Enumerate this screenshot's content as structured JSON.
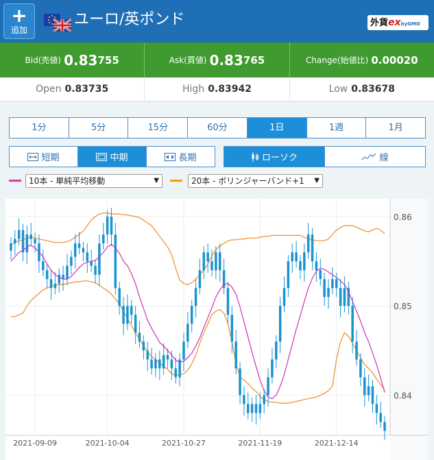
{
  "header": {
    "add_label": "追加",
    "title": "ユーロ/英ポンド",
    "logo_main": "外貨",
    "logo_ex": "ex",
    "logo_sub": "byGMO",
    "colors": {
      "header_bg": "#1e6fb6",
      "quote_bg": "#3f9a2f"
    }
  },
  "quote": {
    "bid_label": "Bid(売値)",
    "bid_big": "0.83",
    "bid_small": "755",
    "ask_label": "Ask(買値)",
    "ask_big": "0.83",
    "ask_small": "765",
    "change_label": "Change(始値比)",
    "change_value": "0.00020"
  },
  "ohl": {
    "open_label": "Open",
    "open_value": "0.83735",
    "high_label": "High",
    "high_value": "0.83942",
    "low_label": "Low",
    "low_value": "0.83678"
  },
  "periods": [
    {
      "label": "1分",
      "active": false
    },
    {
      "label": "5分",
      "active": false
    },
    {
      "label": "15分",
      "active": false
    },
    {
      "label": "60分",
      "active": false
    },
    {
      "label": "1日",
      "active": true
    },
    {
      "label": "1週",
      "active": false
    },
    {
      "label": "1月",
      "active": false
    }
  ],
  "ranges": {
    "short": "短期",
    "mid": "中期",
    "long": "長期",
    "active": "mid"
  },
  "chart_types": {
    "candle": "ローソク",
    "line": "線",
    "active": "candle"
  },
  "indicators": {
    "ma_label": "10本 - 単純平均移動",
    "ma_color": "#d63aa5",
    "bb_label": "20本 - ボリンジャーバンド+1",
    "bb_color": "#f0a000"
  },
  "chart_data": {
    "type": "candlestick",
    "ylim": [
      0.8355,
      0.862
    ],
    "y_ticks": [
      0.84,
      0.85,
      0.86
    ],
    "y_tick_labels": [
      "0.84",
      "0.85",
      "0.86"
    ],
    "x_tick_labels": [
      "2021-09-09",
      "2021-10-04",
      "2021-10-27",
      "2021-11-19",
      "2021-12-14"
    ],
    "x_tick_index": [
      6,
      24,
      43,
      62,
      81
    ],
    "candle_color": "#1a93cf",
    "ma_color": "#c733b8",
    "bb_color": "#f08a24",
    "close": [
      0.857,
      0.8575,
      0.8585,
      0.856,
      0.858,
      0.8575,
      0.857,
      0.855,
      0.854,
      0.853,
      0.852,
      0.8525,
      0.8535,
      0.853,
      0.8545,
      0.8555,
      0.857,
      0.8565,
      0.856,
      0.855,
      0.8545,
      0.8535,
      0.857,
      0.858,
      0.86,
      0.858,
      0.852,
      0.85,
      0.848,
      0.85,
      0.849,
      0.847,
      0.846,
      0.845,
      0.844,
      0.843,
      0.844,
      0.843,
      0.8445,
      0.844,
      0.843,
      0.842,
      0.844,
      0.846,
      0.848,
      0.85,
      0.852,
      0.854,
      0.856,
      0.855,
      0.854,
      0.856,
      0.854,
      0.852,
      0.849,
      0.846,
      0.843,
      0.84,
      0.839,
      0.838,
      0.839,
      0.838,
      0.839,
      0.84,
      0.842,
      0.844,
      0.846,
      0.85,
      0.852,
      0.855,
      0.856,
      0.855,
      0.854,
      0.856,
      0.858,
      0.855,
      0.854,
      0.853,
      0.851,
      0.852,
      0.853,
      0.852,
      0.85,
      0.852,
      0.85,
      0.846,
      0.844,
      0.842,
      0.84,
      0.841,
      0.839,
      0.838,
      0.837,
      0.836
    ],
    "ma10": [
      0.855,
      0.8555,
      0.856,
      0.8562,
      0.8566,
      0.8568,
      0.8565,
      0.856,
      0.8555,
      0.8547,
      0.854,
      0.8535,
      0.8532,
      0.853,
      0.853,
      0.8533,
      0.8538,
      0.8543,
      0.8547,
      0.8549,
      0.855,
      0.8551,
      0.8555,
      0.856,
      0.8566,
      0.8569,
      0.8565,
      0.8559,
      0.855,
      0.8545,
      0.8536,
      0.8525,
      0.851,
      0.8497,
      0.8484,
      0.8475,
      0.8467,
      0.8459,
      0.8455,
      0.845,
      0.8445,
      0.8439,
      0.8437,
      0.8438,
      0.8442,
      0.8447,
      0.8455,
      0.8464,
      0.8476,
      0.8487,
      0.8498,
      0.851,
      0.8518,
      0.8524,
      0.8525,
      0.8521,
      0.8513,
      0.8499,
      0.8482,
      0.8465,
      0.8448,
      0.8432,
      0.8417,
      0.8405,
      0.8398,
      0.8396,
      0.84,
      0.841,
      0.8423,
      0.844,
      0.8457,
      0.8474,
      0.8489,
      0.8505,
      0.852,
      0.8531,
      0.8539,
      0.8542,
      0.8541,
      0.8538,
      0.8535,
      0.8532,
      0.8528,
      0.8524,
      0.8516,
      0.8505,
      0.8494,
      0.8483,
      0.847,
      0.846,
      0.8447,
      0.8434,
      0.8419,
      0.8403
    ],
    "bb_upper": [
      0.8568,
      0.8571,
      0.8573,
      0.8574,
      0.8576,
      0.8577,
      0.8576,
      0.8575,
      0.8574,
      0.8573,
      0.8572,
      0.8571,
      0.8571,
      0.8571,
      0.8572,
      0.8574,
      0.8577,
      0.858,
      0.8584,
      0.859,
      0.8596,
      0.86,
      0.8603,
      0.8604,
      0.8604,
      0.8603,
      0.8603,
      0.8603,
      0.8602,
      0.8602,
      0.8601,
      0.86,
      0.8599,
      0.8596,
      0.8593,
      0.859,
      0.8584,
      0.8578,
      0.8572,
      0.8566,
      0.8557,
      0.8542,
      0.8529,
      0.8525,
      0.8524,
      0.8526,
      0.853,
      0.8535,
      0.854,
      0.8547,
      0.8556,
      0.8563,
      0.8567,
      0.857,
      0.8573,
      0.8574,
      0.8574,
      0.8575,
      0.8575,
      0.8576,
      0.8576,
      0.8576,
      0.8577,
      0.8578,
      0.8578,
      0.8579,
      0.8579,
      0.8579,
      0.8579,
      0.8579,
      0.8579,
      0.8579,
      0.8579,
      0.8577,
      0.8575,
      0.8574,
      0.8573,
      0.8573,
      0.8573,
      0.8575,
      0.858,
      0.8585,
      0.8588,
      0.859,
      0.859,
      0.859,
      0.8588,
      0.8586,
      0.8584,
      0.8583,
      0.8585,
      0.8587,
      0.8585,
      0.8581
    ],
    "bb_lower": [
      0.8488,
      0.8488,
      0.849,
      0.8492,
      0.85,
      0.8506,
      0.851,
      0.8514,
      0.8518,
      0.852,
      0.8522,
      0.8523,
      0.8524,
      0.8524,
      0.8525,
      0.8526,
      0.8527,
      0.8527,
      0.8528,
      0.8528,
      0.8527,
      0.8526,
      0.8523,
      0.852,
      0.8517,
      0.8513,
      0.8508,
      0.8502,
      0.8494,
      0.8486,
      0.8478,
      0.847,
      0.8463,
      0.8455,
      0.8449,
      0.8443,
      0.844,
      0.8436,
      0.8432,
      0.8429,
      0.8424,
      0.8422,
      0.8423,
      0.8424,
      0.8428,
      0.8435,
      0.8445,
      0.8458,
      0.847,
      0.848,
      0.849,
      0.8494,
      0.8496,
      0.8492,
      0.848,
      0.846,
      0.8435,
      0.842,
      0.8417,
      0.8413,
      0.8408,
      0.8404,
      0.8398,
      0.8395,
      0.8393,
      0.8392,
      0.8392,
      0.8391,
      0.8391,
      0.8391,
      0.8392,
      0.8393,
      0.8394,
      0.8395,
      0.8396,
      0.8397,
      0.8398,
      0.84,
      0.8402,
      0.8405,
      0.841,
      0.844,
      0.846,
      0.847,
      0.8466,
      0.8458,
      0.845,
      0.8442,
      0.8434,
      0.843,
      0.8425,
      0.8418,
      0.8412,
      0.8406
    ]
  }
}
